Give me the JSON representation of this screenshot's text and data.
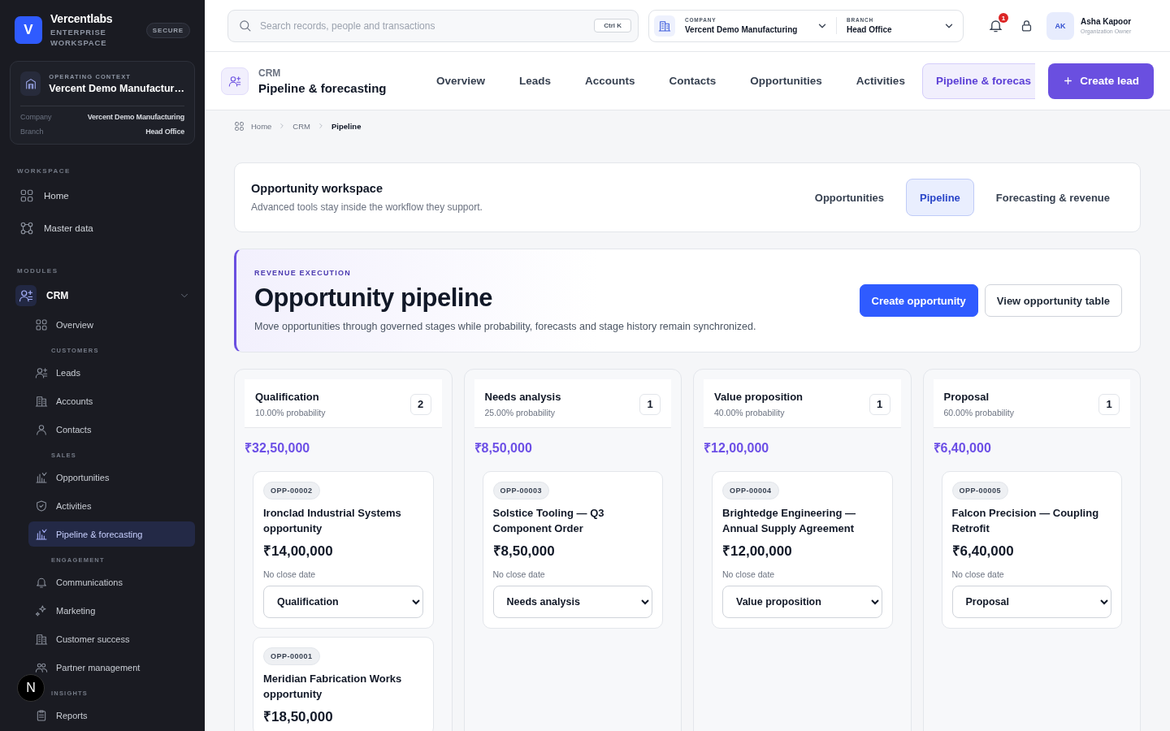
{
  "sidebar": {
    "brand": {
      "logo": "V",
      "name": "Vercentlabs",
      "subtitle": "ENTERPRISE WORKSPACE",
      "badge": "SECURE"
    },
    "context": {
      "label": "OPERATING CONTEXT",
      "title": "Vercent Demo Manufactur…",
      "rows": [
        {
          "label": "Company",
          "value": "Vercent Demo Manufacturing"
        },
        {
          "label": "Branch",
          "value": "Head Office"
        }
      ]
    },
    "sections": [
      {
        "label": "WORKSPACE",
        "items": [
          {
            "label": "Home",
            "selected": false
          },
          {
            "label": "Master data",
            "selected": false
          }
        ]
      },
      {
        "label": "MODULES",
        "items": [
          {
            "label": "CRM",
            "selected": false,
            "expanded": true,
            "children": [
              {
                "kind": "item",
                "label": "Overview",
                "selected": false
              },
              {
                "kind": "group",
                "label": "CUSTOMERS"
              },
              {
                "kind": "item",
                "label": "Leads",
                "selected": false
              },
              {
                "kind": "item",
                "label": "Accounts",
                "selected": false
              },
              {
                "kind": "item",
                "label": "Contacts",
                "selected": false
              },
              {
                "kind": "group",
                "label": "SALES"
              },
              {
                "kind": "item",
                "label": "Opportunities",
                "selected": false
              },
              {
                "kind": "item",
                "label": "Activities",
                "selected": false
              },
              {
                "kind": "item",
                "label": "Pipeline & forecasting",
                "selected": true
              },
              {
                "kind": "group",
                "label": "ENGAGEMENT"
              },
              {
                "kind": "item",
                "label": "Communications",
                "selected": false
              },
              {
                "kind": "item",
                "label": "Marketing",
                "selected": false
              },
              {
                "kind": "item",
                "label": "Customer success",
                "selected": false
              },
              {
                "kind": "item",
                "label": "Partner management",
                "selected": false
              },
              {
                "kind": "group",
                "label": "INSIGHTS"
              },
              {
                "kind": "item",
                "label": "Reports",
                "selected": false
              }
            ]
          }
        ]
      }
    ],
    "dev_badge": "N"
  },
  "topbar": {
    "search": {
      "placeholder": "Search records, people and transactions",
      "shortcut": "Ctrl K"
    },
    "company": {
      "label": "COMPANY",
      "value": "Vercent Demo Manufacturing"
    },
    "branch": {
      "label": "BRANCH",
      "value": "Head Office"
    },
    "notifications": "1",
    "user": {
      "initials": "AK",
      "name": "Asha Kapoor",
      "role": "Organization Owner"
    }
  },
  "module_header": {
    "crumb": "CRM",
    "title": "Pipeline & forecasting",
    "tabs": [
      {
        "label": "Overview",
        "selected": false
      },
      {
        "label": "Leads",
        "selected": false
      },
      {
        "label": "Accounts",
        "selected": false
      },
      {
        "label": "Contacts",
        "selected": false
      },
      {
        "label": "Opportunities",
        "selected": false
      },
      {
        "label": "Activities",
        "selected": false
      },
      {
        "label": "Pipeline & forecas",
        "selected": true
      }
    ],
    "action": "Create lead"
  },
  "breadcrumb": [
    "Home",
    "CRM",
    "Pipeline"
  ],
  "workspace": {
    "title": "Opportunity workspace",
    "subtitle": "Advanced tools stay inside the workflow they support.",
    "tabs": [
      {
        "label": "Opportunities",
        "selected": false
      },
      {
        "label": "Pipeline",
        "selected": true
      },
      {
        "label": "Forecasting & revenue",
        "selected": false
      }
    ]
  },
  "hero": {
    "eyebrow": "REVENUE EXECUTION",
    "title": "Opportunity pipeline",
    "description": "Move opportunities through governed stages while probability, forecasts and stage history remain synchronized.",
    "buttons": [
      {
        "label": "Create opportunity",
        "kind": "primary"
      },
      {
        "label": "View opportunity table",
        "kind": "secondary"
      }
    ]
  },
  "stages": [
    {
      "name": "Qualification",
      "probability": "10.00% probability",
      "count": "2",
      "total": "₹32,50,000",
      "cards": [
        {
          "id": "OPP-00002",
          "title": "Ironclad Industrial Systems opportunity",
          "amount": "₹14,00,000",
          "close": "No close date",
          "stage": "Qualification"
        },
        {
          "id": "OPP-00001",
          "title": "Meridian Fabrication Works opportunity",
          "amount": "₹18,50,000"
        }
      ]
    },
    {
      "name": "Needs analysis",
      "probability": "25.00% probability",
      "count": "1",
      "total": "₹8,50,000",
      "cards": [
        {
          "id": "OPP-00003",
          "title": "Solstice Tooling — Q3 Component Order",
          "amount": "₹8,50,000",
          "close": "No close date",
          "stage": "Needs analysis"
        }
      ]
    },
    {
      "name": "Value proposition",
      "probability": "40.00% probability",
      "count": "1",
      "total": "₹12,00,000",
      "cards": [
        {
          "id": "OPP-00004",
          "title": "Brightedge Engineering — Annual Supply Agreement",
          "amount": "₹12,00,000",
          "close": "No close date",
          "stage": "Value proposition"
        }
      ]
    },
    {
      "name": "Proposal",
      "probability": "60.00% probability",
      "count": "1",
      "total": "₹6,40,000",
      "cards": [
        {
          "id": "OPP-00005",
          "title": "Falcon Precision — Coupling Retrofit",
          "amount": "₹6,40,000",
          "close": "No close date",
          "stage": "Proposal"
        }
      ]
    }
  ]
}
